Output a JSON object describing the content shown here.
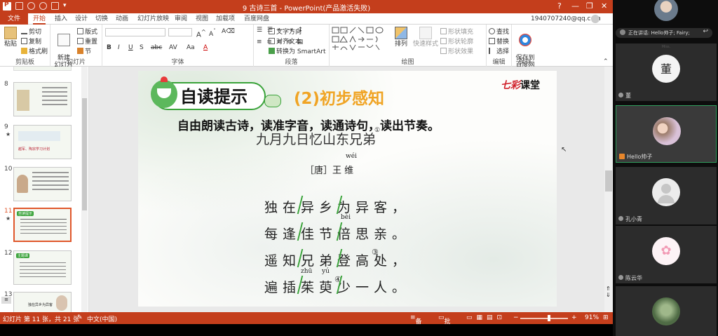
{
  "titlebar": {
    "title": "9 古诗三首 - PowerPoint(产品激活失败)",
    "help": "?",
    "minimize": "—",
    "restore": "❐",
    "close": "✕"
  },
  "menu": {
    "file": "文件",
    "tabs": [
      "开始",
      "插入",
      "设计",
      "切换",
      "动画",
      "幻灯片放映",
      "审阅",
      "视图",
      "加载项",
      "百度网盘"
    ],
    "active_tab": "开始",
    "account": "1940707240@qq.com"
  },
  "ribbon": {
    "clipboard": {
      "label": "剪贴板",
      "paste": "粘贴",
      "cut": "剪切",
      "copy": "复制",
      "format_painter": "格式刷"
    },
    "slides": {
      "label": "幻灯片",
      "new_slide": "新建\n幻灯片",
      "layout": "版式",
      "reset": "重置",
      "section": "节"
    },
    "font": {
      "label": "字体",
      "bold": "B",
      "italic": "I",
      "underline": "U",
      "shadow": "S",
      "strike": "abc",
      "spacing": "AV",
      "case": "Aa",
      "color": "A"
    },
    "paragraph": {
      "label": "段落",
      "text_direction": "文字方向",
      "align_text": "对齐文本",
      "smartart": "转换为 SmartArt"
    },
    "drawing": {
      "label": "绘图",
      "arrange": "排列",
      "quick_styles": "快速样式",
      "shape_fill": "形状填充",
      "shape_outline": "形状轮廓",
      "shape_effects": "形状效果"
    },
    "editing": {
      "label": "编辑",
      "find": "查找",
      "replace": "替换",
      "select": "选择"
    },
    "baidu": {
      "save": "保存到\n百度网盘",
      "label": "保存"
    }
  },
  "thumbnails": [
    {
      "num": "8",
      "star": false,
      "selected": false
    },
    {
      "num": "9",
      "star": true,
      "selected": false,
      "text": "越军、陶宗学习计划"
    },
    {
      "num": "10",
      "star": false,
      "selected": false
    },
    {
      "num": "11",
      "star": true,
      "selected": true,
      "header": "自读提示"
    },
    {
      "num": "12",
      "star": false,
      "selected": false,
      "header": "主题课"
    },
    {
      "num": "13",
      "star": false,
      "selected": false,
      "text": "独在异乡为异客"
    }
  ],
  "slide": {
    "badge": "自读提示",
    "subtitle": "(2)初步感知",
    "brand_red": "七彩",
    "brand_black": "课堂",
    "instruction": "自由朗读古诗，读准字音，读通诗句，读出节奏。",
    "poem_title": "九月九日忆山东兄弟",
    "annot_title": "①",
    "author": "［唐］王  维",
    "author_pinyin": "wéi",
    "lines": [
      "独在异乡为异客，",
      "每逢佳节倍思亲。",
      "遥知兄弟登高处，",
      "遍插茱萸少一人。"
    ],
    "pinyin_bei": "bèi",
    "pinyin_zhu": "zhū",
    "pinyin_yu": "yú",
    "circle3": "③",
    "circle4": "④"
  },
  "status": {
    "slide_info": "幻灯片 第 11 张，共 21 张",
    "language": "中文(中国)",
    "notes": "备注",
    "comments": "批注",
    "zoom": "91%"
  },
  "meeting": {
    "speaking_label": "正在讲话: Hello帅子; Fairy;",
    "participants": [
      {
        "name": "董",
        "avatar_text": "董",
        "avatar_small": "Miss."
      },
      {
        "name": "Hello帅子",
        "mic": true
      },
      {
        "name": "孔小青"
      },
      {
        "name": "陈云华"
      }
    ]
  },
  "colors": {
    "accent": "#c43e1c",
    "green": "#3aa33a",
    "orange": "#f0a424"
  }
}
